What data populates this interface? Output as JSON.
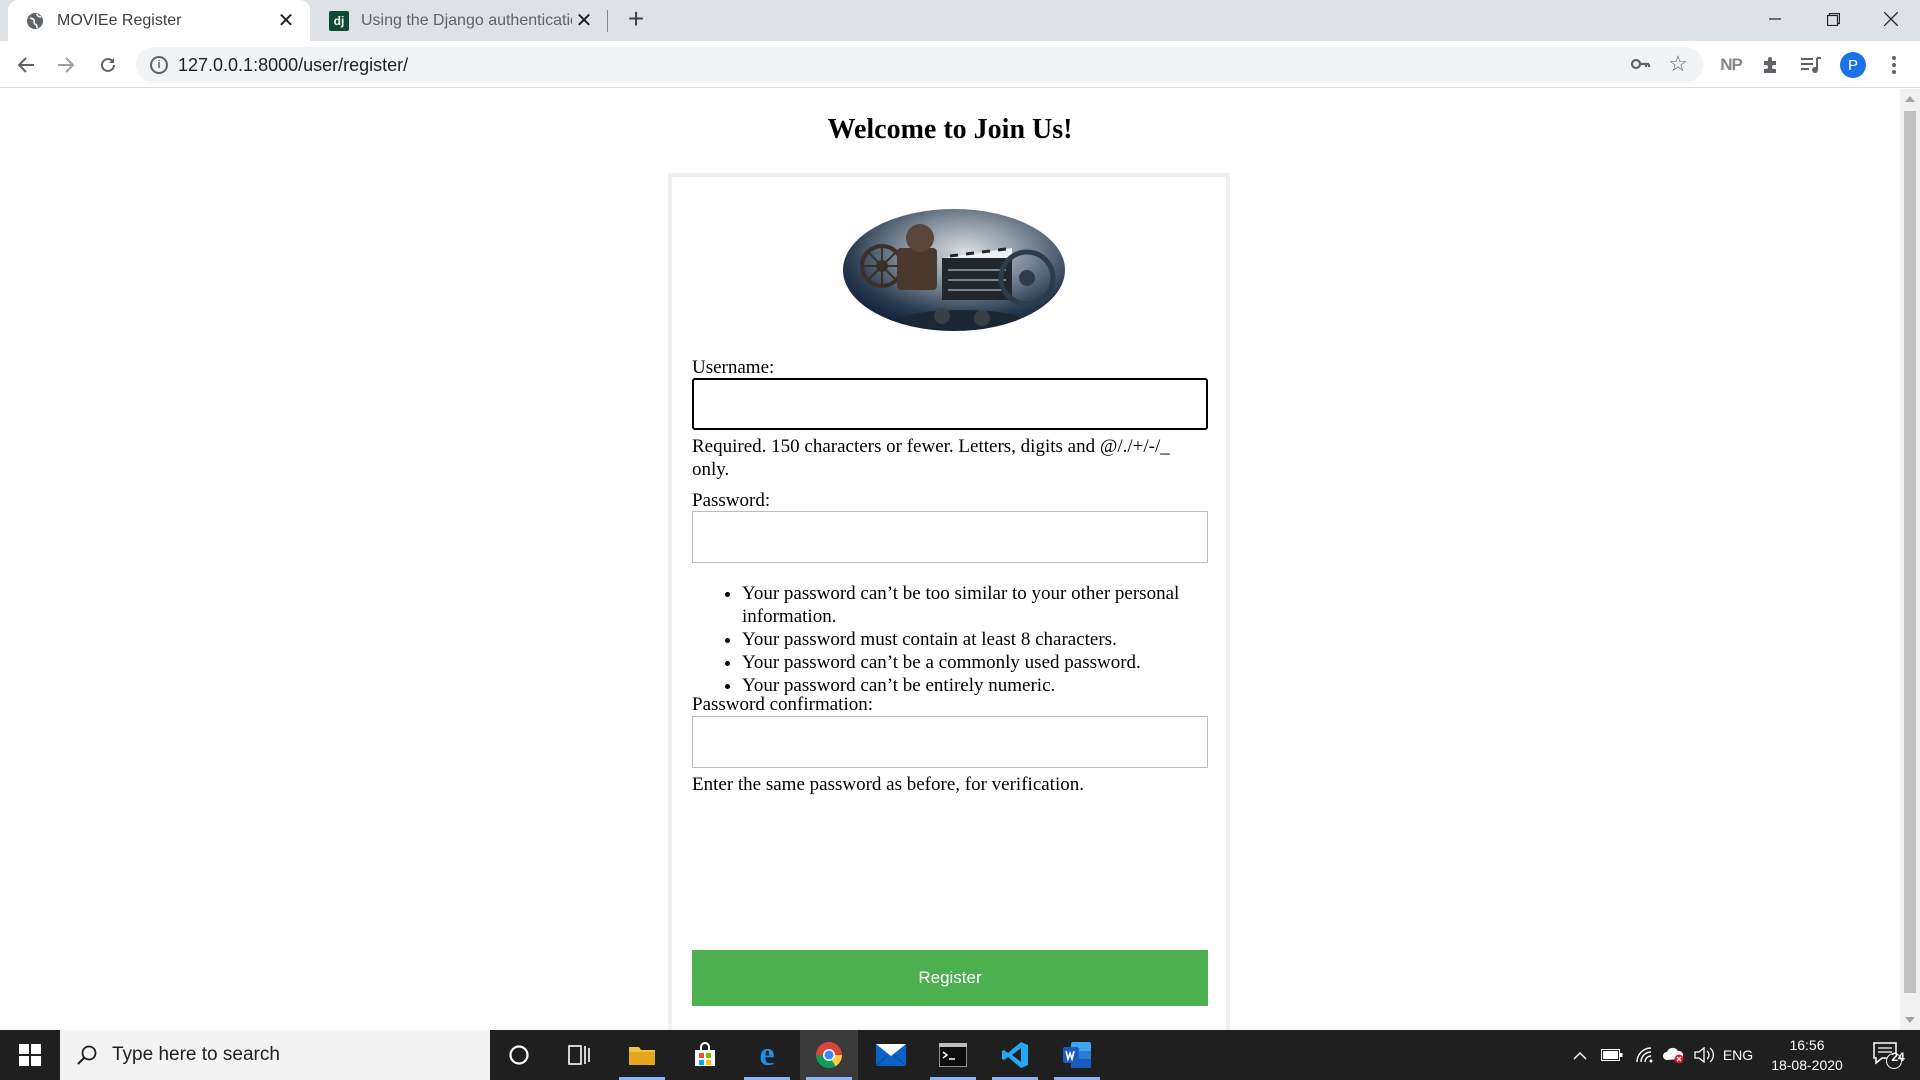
{
  "browser": {
    "tabs": [
      {
        "title": "MOVIEe Register",
        "active": true,
        "favicon": "globe-icon"
      },
      {
        "title": "Using the Django authentication",
        "active": false,
        "favicon": "django-icon",
        "favicon_text": "dj"
      }
    ],
    "address": "127.0.0.1:8000/user/register/",
    "extension_np": "NP",
    "profile_initial": "P"
  },
  "page": {
    "heading": "Welcome to Join Us!",
    "logo": "movie-projector-image",
    "username": {
      "label": "Username:",
      "value": "",
      "help": "Required. 150 characters or fewer. Letters, digits and @/./+/-/_ only."
    },
    "password": {
      "label": "Password:",
      "value": "",
      "rules": [
        "Your password can’t be too similar to your other personal information.",
        "Your password must contain at least 8 characters.",
        "Your password can’t be a commonly used password.",
        "Your password can’t be entirely numeric."
      ]
    },
    "password_confirmation": {
      "label": "Password confirmation:",
      "value": "",
      "help": "Enter the same password as before, for verification."
    },
    "submit_label": "Register",
    "accent_color": "#4caf50"
  },
  "taskbar": {
    "search_placeholder": "Type here to search",
    "apps": [
      "cortana-icon",
      "task-view-icon",
      "file-explorer-icon",
      "store-icon",
      "edge-icon",
      "chrome-icon",
      "mail-icon",
      "terminal-icon",
      "vscode-icon",
      "word-icon"
    ],
    "language": "ENG",
    "time": "16:56",
    "date": "18-08-2020",
    "notifications": "24"
  }
}
